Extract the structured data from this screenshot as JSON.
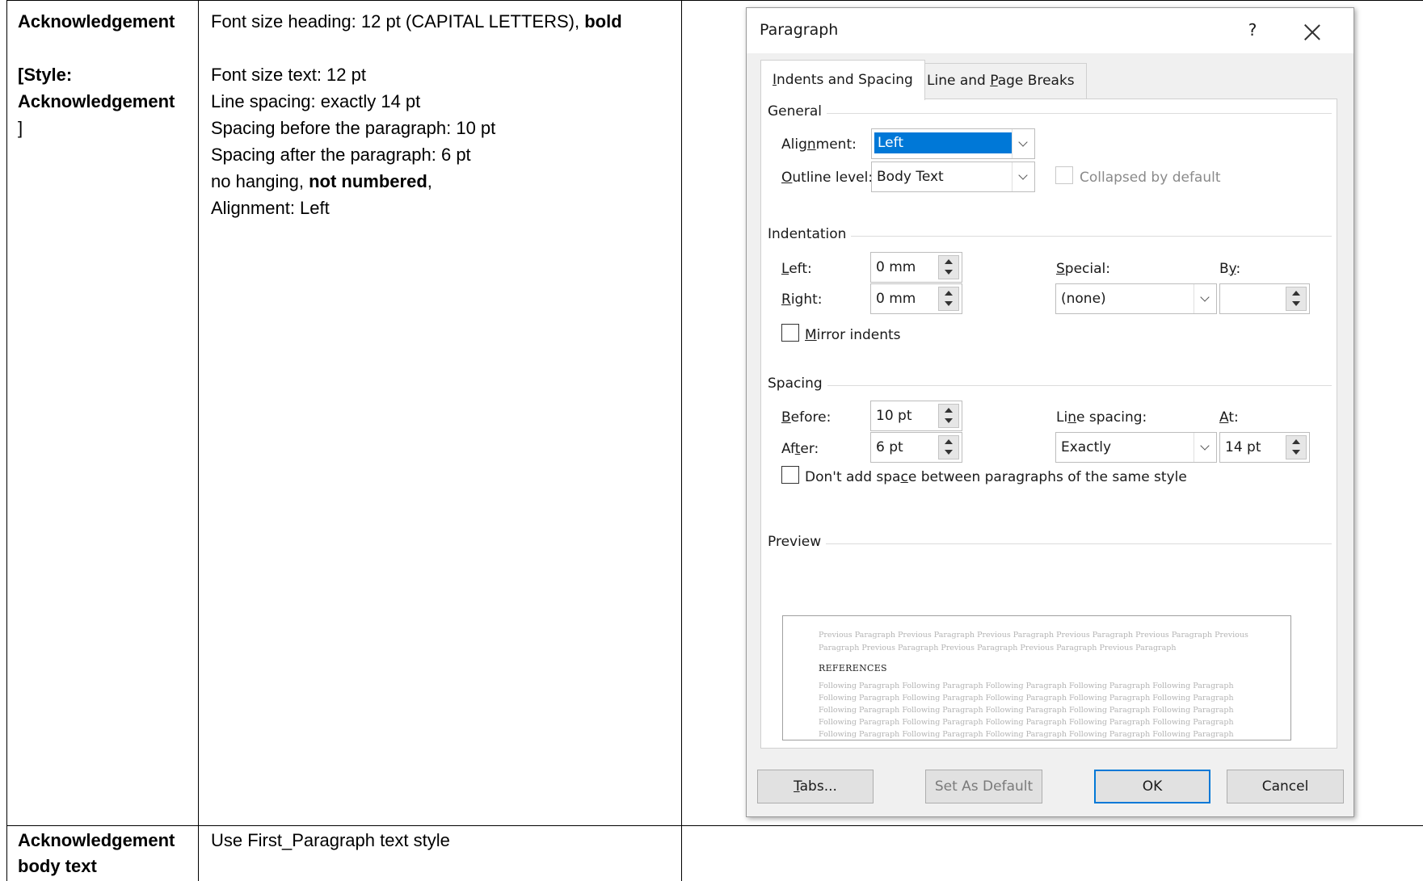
{
  "table": {
    "row1": {
      "col1_lines": [
        "Acknowledgement",
        "",
        "[Style:",
        "Acknowledgement",
        "]"
      ],
      "col2_line1_prefix": "Font size heading: 12 pt (CAPITAL LETTERS), ",
      "col2_line1_bold": "bold",
      "col2_line2": "Font size text: 12 pt",
      "col2_line3": "Line spacing: exactly 14 pt",
      "col2_line4": "Spacing before the paragraph: 10 pt",
      "col2_line5": "Spacing after the paragraph: 6 pt",
      "col2_line6_prefix": "no hanging, ",
      "col2_line6_bold": "not numbered",
      "col2_line6_suffix": ",",
      "col2_line7": "Alignment: Left"
    },
    "row2": {
      "col1_lines": [
        "Acknowledgement",
        "body text"
      ],
      "col2": "Use First_Paragraph text style"
    }
  },
  "dialog": {
    "title": "Paragraph",
    "help": "?",
    "tabs": [
      {
        "label": "Indents and Spacing",
        "mnemonic": "I",
        "rest": "ndents and Spacing",
        "active": true
      },
      {
        "label": "Line and Page Breaks",
        "pre": "Line and ",
        "mnemonic": "P",
        "rest": "age Breaks",
        "active": false
      }
    ],
    "general": {
      "group": "General",
      "alignment_pre": "Alig",
      "alignment_mn": "n",
      "alignment_post": "ment:",
      "alignment_value": "Left",
      "outline_mn": "O",
      "outline_post": "utline level:",
      "outline_value": "Body Text",
      "collapsed_label": "Collapsed by default"
    },
    "indentation": {
      "group": "Indentation",
      "left_mn": "L",
      "left_post": "eft:",
      "left_value": "0 mm",
      "right_mn": "R",
      "right_post": "ight:",
      "right_value": "0 mm",
      "special_mn": "S",
      "special_post": "pecial:",
      "special_value": "(none)",
      "by_pre": "B",
      "by_mn": "y",
      "by_post": ":",
      "by_value": "",
      "mirror_mn": "M",
      "mirror_post": "irror indents"
    },
    "spacing": {
      "group": "Spacing",
      "before_mn": "B",
      "before_post": "efore:",
      "before_value": "10 pt",
      "after_pre": "Af",
      "after_mn": "t",
      "after_post": "er:",
      "after_value": "6 pt",
      "line_pre": "Li",
      "line_mn": "n",
      "line_post": "e spacing:",
      "line_value": "Exactly",
      "at_mn": "A",
      "at_post": "t:",
      "at_value": "14 pt",
      "dontadd_pre": "Don't add spa",
      "dontadd_mn": "c",
      "dontadd_post": "e between paragraphs of the same style"
    },
    "preview": {
      "group": "Preview",
      "previous_text": "Previous Paragraph Previous Paragraph Previous Paragraph Previous Paragraph Previous Paragraph Previous Paragraph Previous Paragraph Previous Paragraph Previous Paragraph Previous Paragraph",
      "sample_heading": "REFERENCES",
      "following_lines": [
        "Following Paragraph Following Paragraph Following Paragraph Following Paragraph Following Paragraph",
        "Following Paragraph Following Paragraph Following Paragraph Following Paragraph Following Paragraph",
        "Following Paragraph Following Paragraph Following Paragraph Following Paragraph Following Paragraph",
        "Following Paragraph Following Paragraph Following Paragraph Following Paragraph Following Paragraph",
        "Following Paragraph Following Paragraph Following Paragraph Following Paragraph Following Paragraph"
      ]
    },
    "buttons": {
      "tabs_mn": "T",
      "tabs_post": "abs...",
      "set_default": "Set As Default",
      "ok": "OK",
      "cancel": "Cancel"
    },
    "colors": {
      "selection": "#0078d7",
      "dialog_bg": "#f0f0f0",
      "panel_bg": "#ffffff"
    }
  }
}
